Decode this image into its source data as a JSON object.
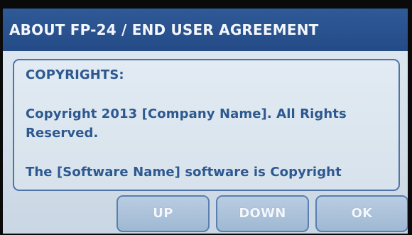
{
  "dialog": {
    "title": "ABOUT FP-24 / END USER AGREEMENT"
  },
  "content": {
    "heading": "COPYRIGHTS:",
    "paragraph1_line1": "Copyright 2013 [Company Name]. All Rights",
    "paragraph1_line2": "Reserved.",
    "paragraph2": "The [Software Name] software is Copyright"
  },
  "buttons": {
    "up_label": "UP",
    "down_label": "DOWN",
    "ok_label": "OK"
  },
  "colors": {
    "title_bar": "#244b86",
    "text": "#2d5890",
    "button_fill": "#a9c0d8",
    "border": "#4d74a8"
  }
}
